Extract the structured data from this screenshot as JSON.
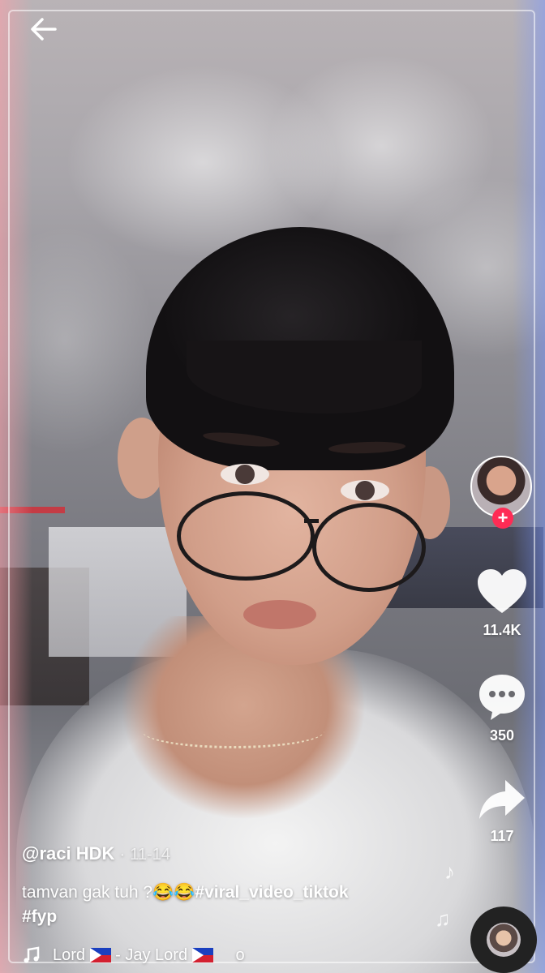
{
  "nav": {
    "back_icon": "arrow-left-icon"
  },
  "creator": {
    "handle": "@raci HDK",
    "separator": "·",
    "date": "11-14"
  },
  "caption": {
    "text": "tamvan gak tuh ?😂😂",
    "hashtags": [
      "#viral_video_tiktok",
      "#fyp"
    ]
  },
  "actions": {
    "follow_symbol": "+",
    "likes": "11.4K",
    "comments": "350",
    "shares": "117"
  },
  "music": {
    "part1": "Lord",
    "part2": "- Jay Lord",
    "part3": "o"
  },
  "colors": {
    "follow_accent": "#fe2c55",
    "text": "#ffffff"
  }
}
